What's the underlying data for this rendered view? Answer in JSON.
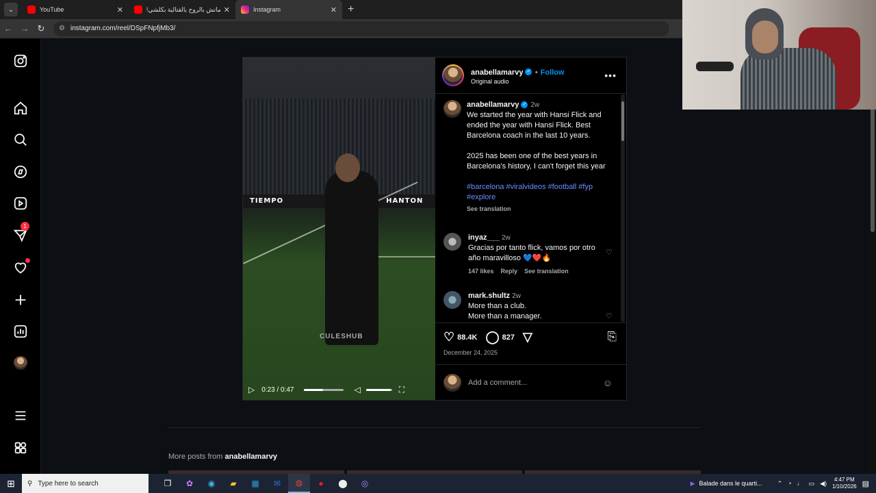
{
  "browser": {
    "tabs": [
      {
        "title": "YouTube",
        "favicon_color": "#ff0000",
        "active": false
      },
      {
        "title": "ماتش بالروح بالقتالية بكلشي! تس...",
        "favicon_color": "#ff0000",
        "active": false
      },
      {
        "title": "Instagram",
        "favicon_color": "#e1306c",
        "active": true
      }
    ],
    "new_tab": "+",
    "url": "instagram.com/reel/DSpFNpfjMb3/"
  },
  "nav": {
    "notification_count": "1"
  },
  "video": {
    "ad_text": "TIEMPO",
    "ad_text2": "HANTON",
    "watermark": "CULESHUB",
    "time": "0:23 / 0:47",
    "progress": 0.49,
    "volume": 0.95,
    "cu_text": "@ CU"
  },
  "post": {
    "username": "anabellamarvy",
    "verified": true,
    "follow_label": "Follow",
    "audio": "Original audio",
    "caption": {
      "username": "anabellamarvy",
      "time": "2w",
      "para1": "We started the year with Hansi Flick and ended the year with Hansi Flick. Best Barcelona coach in the last 10 years.",
      "para2": "2025 has been one of the best years in Barcelona's history, I can't forget this year",
      "tags": "#barcelona #viralvideos #football #fyp #explore",
      "see_translation": "See translation"
    },
    "comments": [
      {
        "username": "inyaz___",
        "time": "2w",
        "text": "Gracias por tanto flick, vamos por otro año maravilloso 💙❤️🔥",
        "likes": "147 likes",
        "reply": "Reply",
        "see_translation": "See translation"
      },
      {
        "username": "mark.shultz",
        "time": "2w",
        "line1": "More than a club.",
        "line2": "More than a manager."
      }
    ],
    "likes": "88.4K",
    "comment_count": "827",
    "date": "December 24, 2025",
    "add_comment_placeholder": "Add a comment..."
  },
  "more_posts": {
    "prefix": "More posts from",
    "username": "anabellamarvy"
  },
  "taskbar": {
    "search_placeholder": "Type here to search",
    "now_playing": "Balade dans le quarti...",
    "time": "4:47 PM",
    "date": "1/10/2026"
  },
  "colors": {
    "accent_blue": "#0095f6",
    "notification_red": "#ff3040",
    "hashtag_blue": "#6b8eff",
    "background": "#0c1014"
  }
}
